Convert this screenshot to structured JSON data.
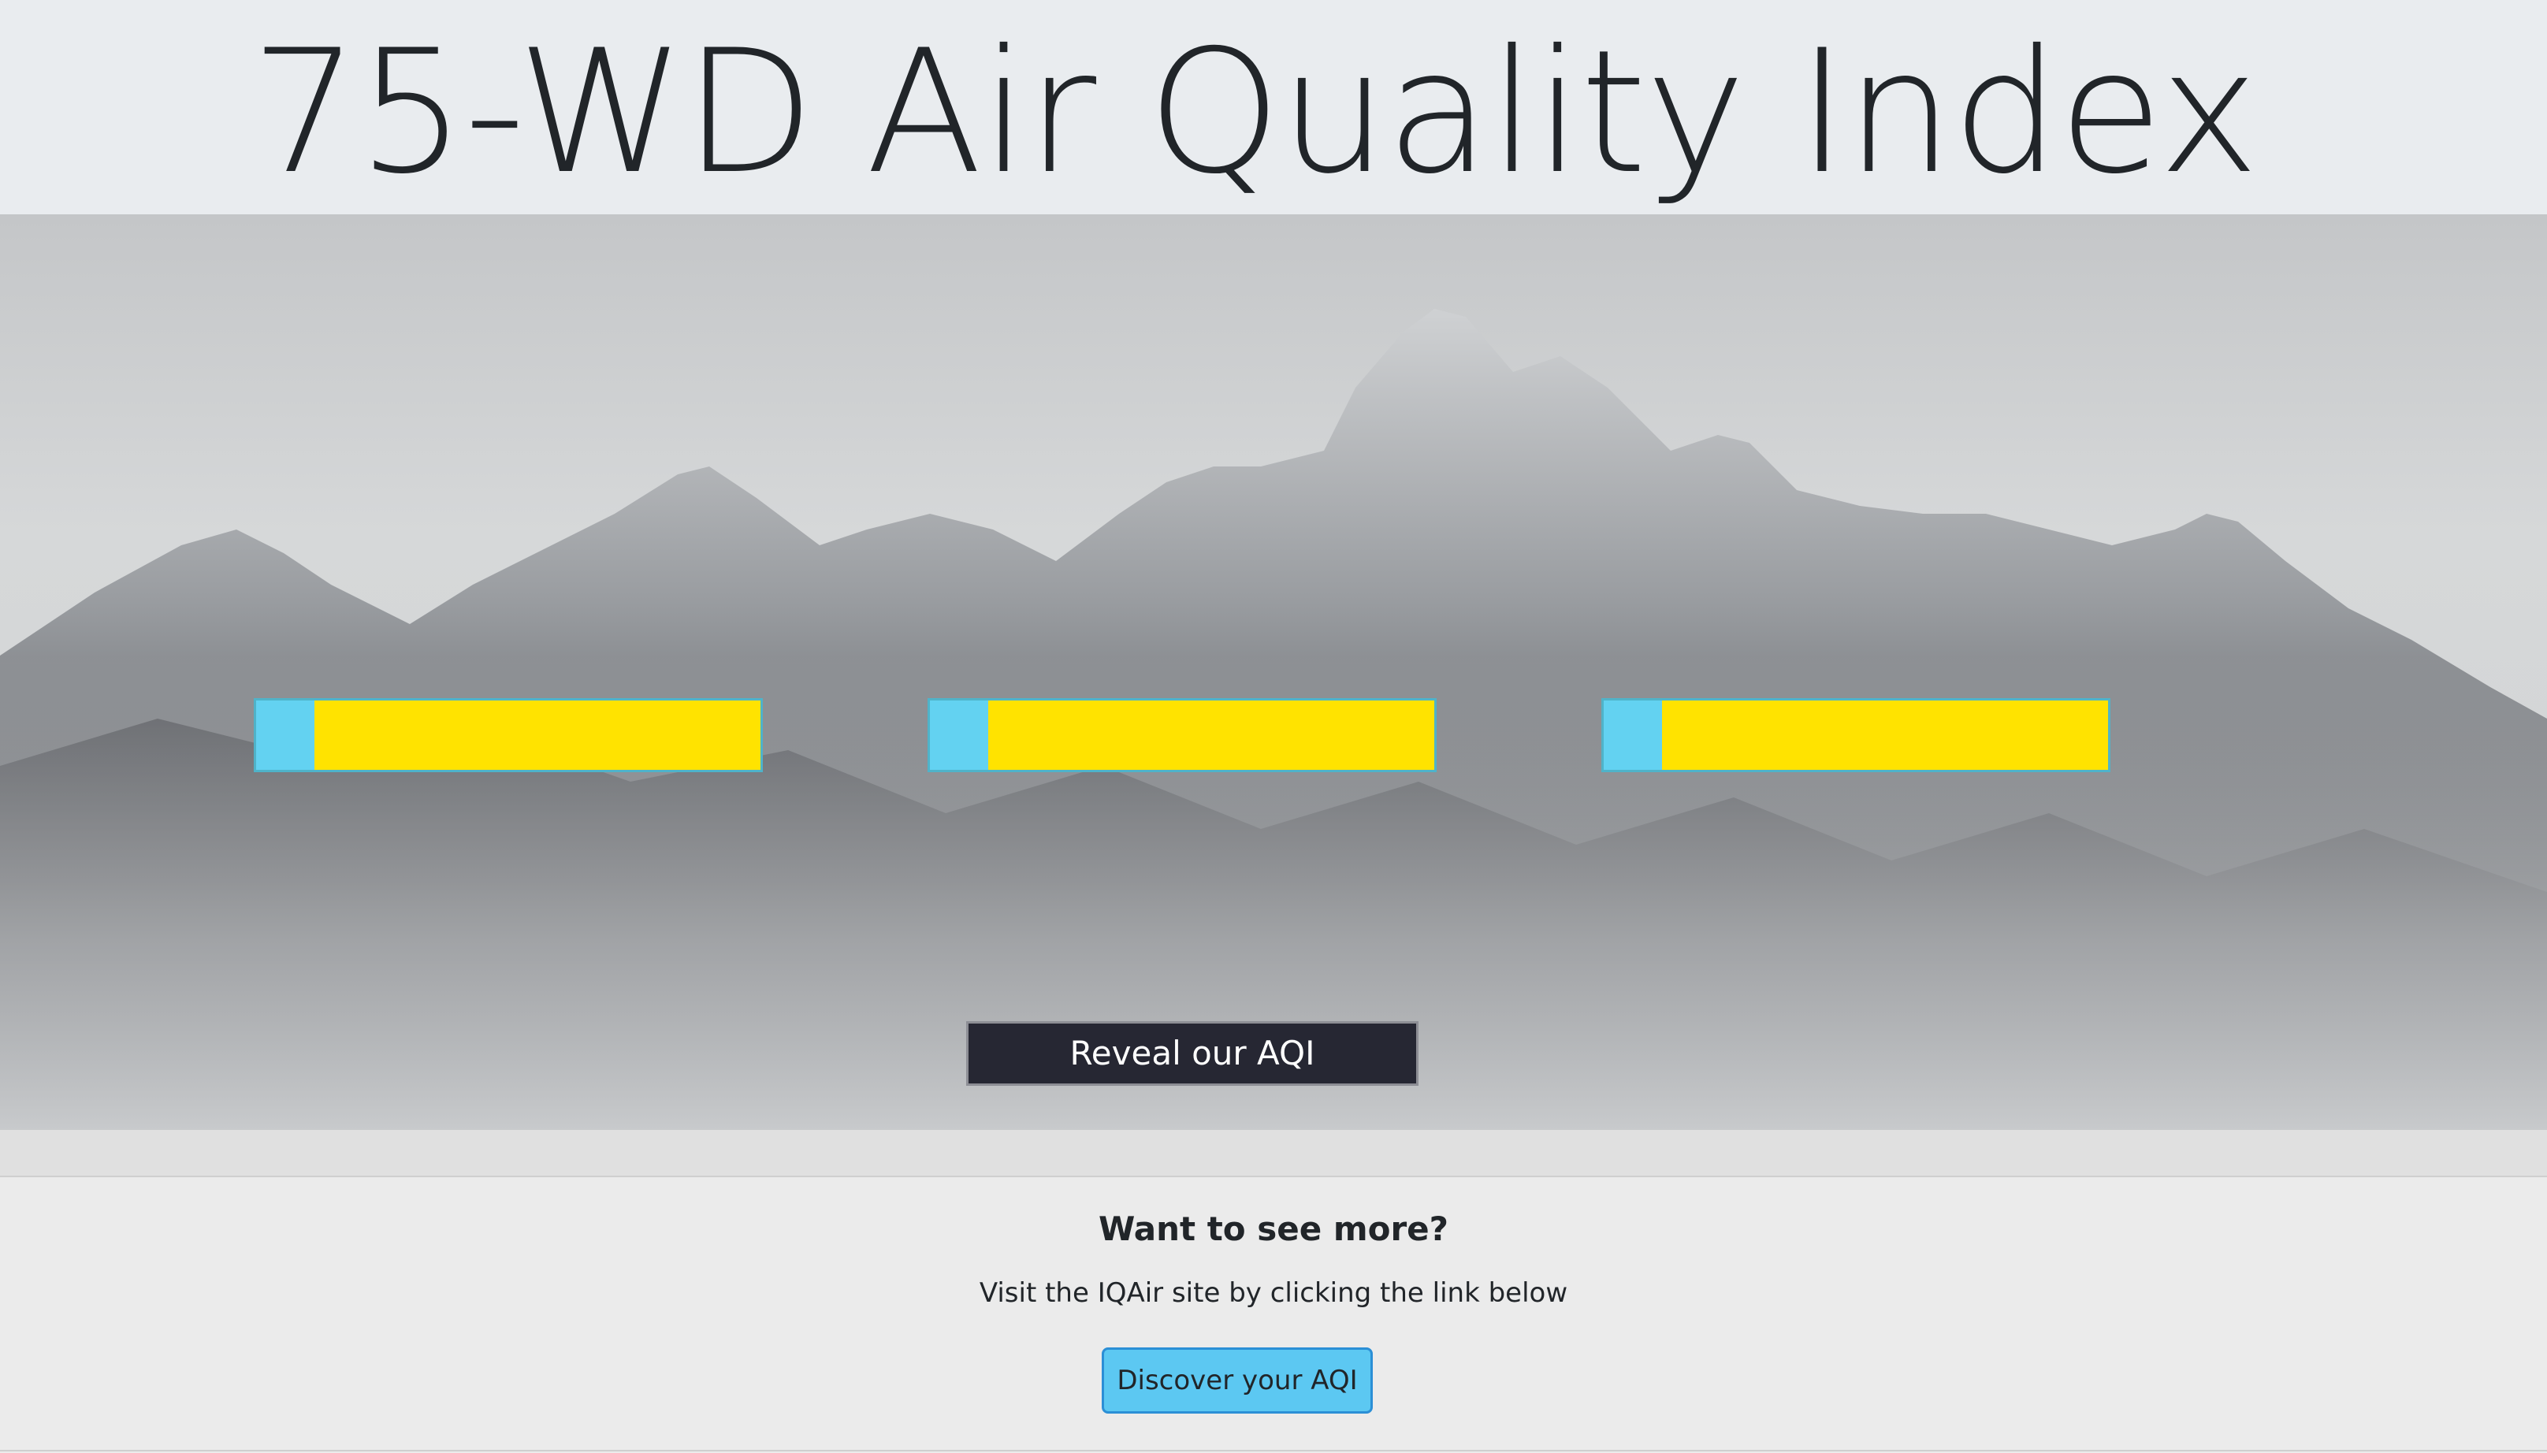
{
  "header": {
    "title": "75-WD Air Quality Index"
  },
  "hero": {
    "background": "mountain-landscape-image",
    "aqi_bars": [
      {
        "level_percent": 11.5,
        "fill_color": "#63d2f1",
        "track_color": "#ffe300"
      },
      {
        "level_percent": 11.5,
        "fill_color": "#63d2f1",
        "track_color": "#ffe300"
      },
      {
        "level_percent": 11.5,
        "fill_color": "#63d2f1",
        "track_color": "#ffe300"
      }
    ],
    "reveal_label": "Reveal our AQI"
  },
  "footer": {
    "heading": "Want to see more?",
    "text": "Visit the IQAir site by clicking the link below",
    "button_label": "Discover your AQI",
    "button_color": "#5cc8f2"
  }
}
